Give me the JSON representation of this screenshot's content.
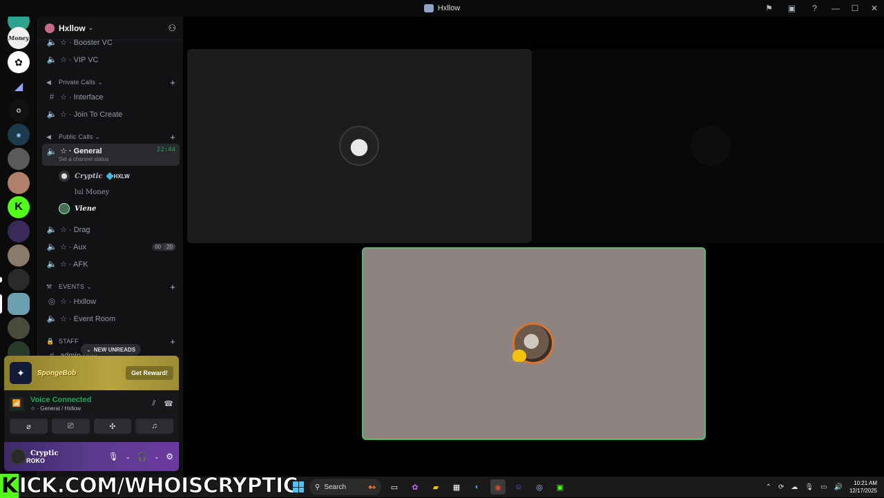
{
  "window": {
    "title": "Hxllow",
    "buttons": [
      "flag-icon",
      "inbox-icon",
      "help-icon",
      "minimize",
      "maximize",
      "close"
    ]
  },
  "colors": {
    "accent_green": "#23a559",
    "sidebar_bg": "#121214",
    "tile_highlight": "#4fbf6a",
    "kick_green": "#53fc18"
  },
  "guild": {
    "name": "Hxllow"
  },
  "channels": {
    "booster_vc": "☆ · Booster VC",
    "vip_vc": "☆ · VIP VC",
    "private_calls": "Private Calls",
    "interface": "☆ · Interface",
    "join_to_create": "☆ · Join To Create",
    "public_calls": "Public Calls",
    "general": "☆ · General",
    "general_timer": "22:44",
    "general_status": "Set a channel status",
    "drag": "☆ · Drag",
    "aux": "☆ · Aux",
    "aux_counts": [
      "00",
      "20"
    ],
    "afk": "☆ · AFK",
    "events": "EVENTS",
    "hxllow": "☆ · Hxllow",
    "event_room": "☆ · Event Room",
    "staff": "STAFF",
    "admin_only": "admin-only"
  },
  "voice_users": [
    {
      "name": "Cryptic",
      "tag": "HXLW"
    },
    {
      "name": "lul Money"
    },
    {
      "name": "Viene"
    }
  ],
  "new_unreads": "NEW UNREADS",
  "promo": {
    "logo_text": "SpongeBob",
    "button": "Get Reward!"
  },
  "voice_panel": {
    "status": "Voice Connected",
    "location": "☆ · General / Hxllow"
  },
  "user": {
    "name": "Cryptic",
    "overlay": "ROKO"
  },
  "overlay_banner": {
    "k": "K",
    "text": "ICK.COM/WHOISCRYPTIC"
  },
  "taskbar": {
    "search_placeholder": "Search",
    "time": "10:21 AM",
    "date": "12/17/2025"
  }
}
